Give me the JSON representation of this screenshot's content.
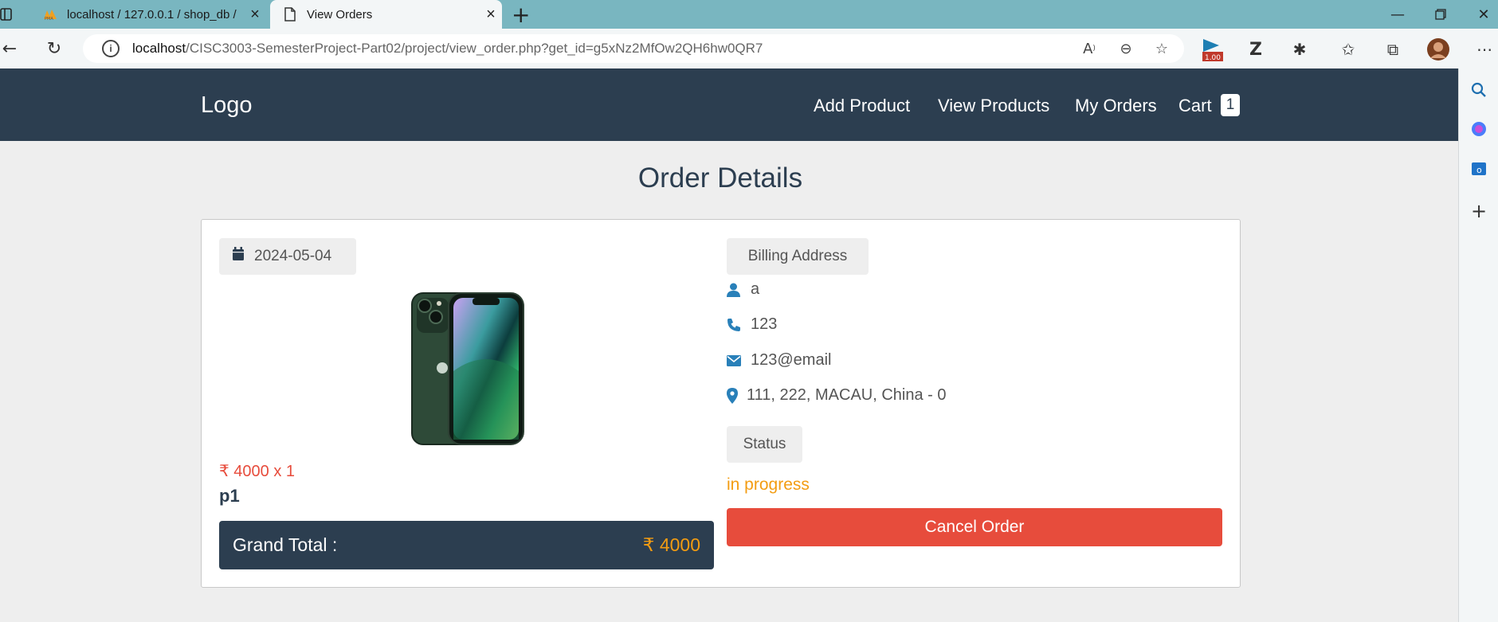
{
  "browser": {
    "tabs": [
      {
        "title": "localhost / 127.0.0.1 / shop_db /",
        "favicon": "phpmyadmin-icon"
      },
      {
        "title": "View Orders",
        "favicon": "page-icon"
      }
    ],
    "url_host": "localhost",
    "url_path": "/CISC3003-SemesterProject-Part02/project/view_order.php?get_id=g5xNz2MfOw2QH6hw0QR7",
    "extension_badge": "1.00"
  },
  "header": {
    "logo": "Logo",
    "nav": [
      "Add Product",
      "View Products",
      "My Orders",
      "Cart"
    ],
    "cart_count": "1"
  },
  "page": {
    "heading": "Order Details"
  },
  "order": {
    "date": "2024-05-04",
    "currency_symbol": "₹",
    "price_line": "4000 x 1",
    "product_name": "p1",
    "grand_total_label": "Grand Total :",
    "grand_total_value": "4000",
    "billing_label": "Billing Address",
    "name": "a",
    "phone": "123",
    "email": "123@email",
    "address": "111, 222, MACAU, China - 0",
    "status_label": "Status",
    "status_value": "in progress",
    "cancel_button": "Cancel Order"
  },
  "colors": {
    "navy": "#2c3e50",
    "accent_red": "#e74c3c",
    "accent_orange": "#f39c12",
    "icon_blue": "#2980b9"
  }
}
